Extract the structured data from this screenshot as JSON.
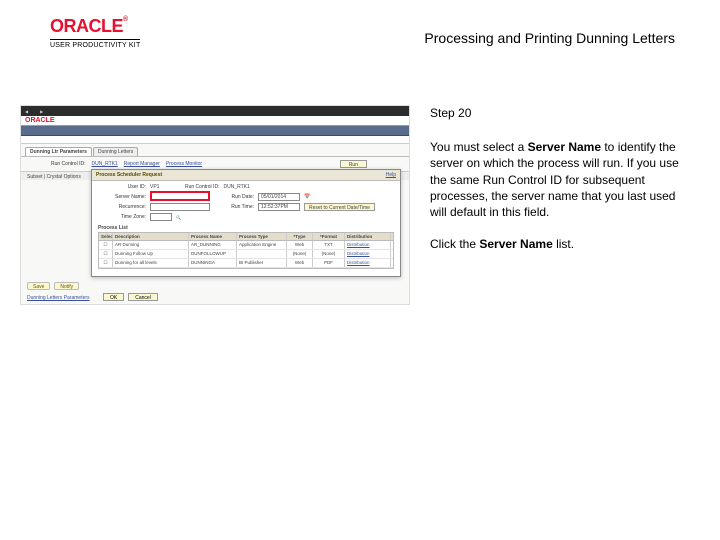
{
  "logo": {
    "brand": "ORACLE",
    "reg": "®",
    "sub": "USER PRODUCTIVITY KIT"
  },
  "title": "Processing and Printing Dunning Letters",
  "step": "Step 20",
  "body_parts": [
    "You must select a ",
    "Server Name",
    " to identify the server on which the process will run. If you use the same Run Control ID for subsequent processes, the server name that you last used will default in this field."
  ],
  "action_parts": [
    "Click the ",
    "Server Name",
    " list."
  ],
  "ss": {
    "oracle": "ORACLE",
    "tabs": {
      "active": "Dunning Ltr Parameters",
      "other": "Dunning Letters"
    },
    "run": {
      "label": "Run Control ID:",
      "value": "DUN_RTK1",
      "report": "Report Manager",
      "monitor": "Process Monitor",
      "btn": "Run"
    },
    "subtabs": "Subset  |  Crystal Options",
    "dialog": {
      "title": "Process Scheduler Request",
      "help": "Help",
      "user_lbl": "User ID:",
      "user_val": "VP1",
      "runctl_lbl": "Run Control ID:",
      "runctl_val": "DUN_RTK1",
      "server_lbl": "Server Name:",
      "rundate_lbl": "Run Date:",
      "rundate_val": "05/01/2014",
      "runtime_lbl": "Run Time:",
      "runtime_val": "12:52:37PM",
      "reset": "Reset to Current Date/Time",
      "recur_lbl": "Recurrence:",
      "tz_lbl": "Time Zone:",
      "list_title": "Process List",
      "head": {
        "sel": "Select",
        "desc": "Description",
        "pname": "Process Name",
        "ptype": "Process Type",
        "type": "*Type",
        "fmt": "*Format",
        "dist": "Distribution"
      },
      "rows": [
        {
          "desc": "AR Dunning",
          "pname": "AR_DUNNING",
          "ptype": "Application Engine",
          "type": "Web",
          "fmt": "TXT",
          "dist": "Distribution"
        },
        {
          "desc": "Dunning Follow Up",
          "pname": "DUNFOLLOWUP",
          "ptype": "",
          "type": "(None)",
          "fmt": "(None)",
          "dist": "Distribution"
        },
        {
          "desc": "Dunning for all levels",
          "pname": "DUNNINGA",
          "ptype": "BI Publisher",
          "type": "Web",
          "fmt": "PDF",
          "dist": "Distribution"
        }
      ],
      "ok": "OK",
      "cancel": "Cancel"
    },
    "footer": {
      "save": "Save",
      "notify": "Notify"
    },
    "bottomlink": "Dunning Letters Parameters"
  }
}
